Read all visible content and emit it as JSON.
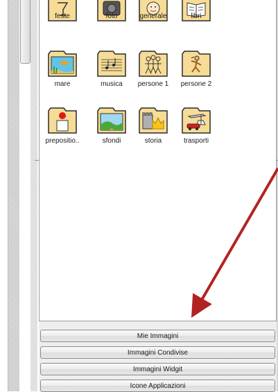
{
  "folders": {
    "row1": [
      "feste",
      "foto",
      "generale",
      "libri"
    ],
    "row2": [
      "mare",
      "musica",
      "persone 1",
      "persone 2"
    ],
    "row3": [
      "prepositio..",
      "sfondi",
      "storia",
      "trasporti"
    ]
  },
  "tabs": {
    "mie_immagini": "Mie Immagini",
    "immagini_condivise": "Immagini Condivise",
    "immagini_widgit": "Immagini Widgit",
    "icone_applicazioni": "Icone Applicazioni"
  },
  "colors": {
    "folder_fill": "#f6dc96",
    "folder_outline": "#2a2a2a",
    "arrow": "#b32222",
    "tab_border": "#8a8a8a"
  }
}
